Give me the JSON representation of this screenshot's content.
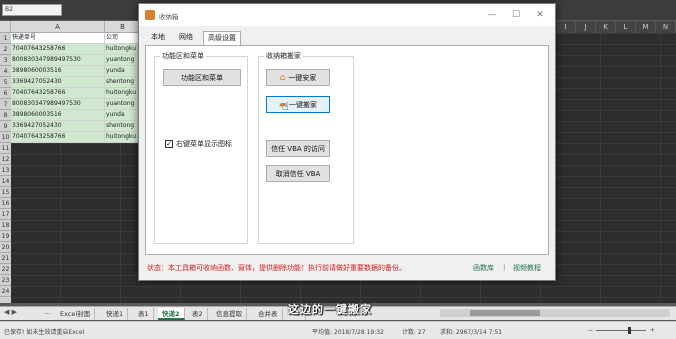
{
  "excel": {
    "name_box": "B2",
    "columns_left": [
      "A",
      "B"
    ],
    "columns_right": [
      "I",
      "J",
      "K",
      "L",
      "M",
      "N"
    ],
    "row_numbers": [
      "1",
      "2",
      "3",
      "4",
      "5",
      "6",
      "7",
      "8",
      "9",
      "10",
      "11",
      "12",
      "13",
      "14",
      "15",
      "16",
      "17",
      "18",
      "19",
      "20",
      "21",
      "22",
      "23",
      "24"
    ],
    "header_row": {
      "col_a": "快递单号",
      "col_b": "公司"
    },
    "rows": [
      {
        "a": "70407643258766",
        "b": "huitongku"
      },
      {
        "a": "8008303479894975​30",
        "b": "yuantong"
      },
      {
        "a": "3898060003516",
        "b": "yunda"
      },
      {
        "a": "3369427052430",
        "b": "shentong"
      },
      {
        "a": "70407643258766",
        "b": "huitongku"
      },
      {
        "a": "800830347989497530",
        "b": "yuantong"
      },
      {
        "a": "3898060003516",
        "b": "yunda"
      },
      {
        "a": "3369427052430",
        "b": "shentong"
      },
      {
        "a": "70407643258766",
        "b": "huitongku"
      }
    ],
    "tab_nav": "◀ ▶",
    "tab_more": "...",
    "sheet_tabs": [
      "Excel封面",
      "快递1",
      "表1",
      "快递2",
      "表2",
      "信息提取",
      "合并表"
    ],
    "active_sheet_index": 3,
    "add_sheet": "+",
    "status": {
      "ready": "已保存! 如未生效请重启Excel",
      "average": "平均值: 2018/7/28 19:32",
      "count": "计数: 27",
      "sum": "求和: 2967/3/14 7:51",
      "zoom_minus": "−",
      "zoom_plus": "+"
    }
  },
  "subtitle": "这边的一键搬家",
  "dialog": {
    "title": "收纳箱",
    "window_buttons": {
      "minimize": "—",
      "maximize": "☐",
      "close": "✕"
    },
    "tabs": [
      "本地",
      "网络",
      "高级设置"
    ],
    "active_tab_index": 2,
    "group_left_title": "功能区和菜单",
    "group_right_title": "收纳箱搬家",
    "btn_ribbon_menu": "功能区和菜单",
    "checkbox_label": "右键菜单显示图标",
    "checkbox_checked": "✓",
    "btn_install": "一键安家",
    "btn_move": "一键搬家",
    "btn_trust_vba": "信任 VBA 的访问",
    "btn_untrust_vba": "取消信任 VBA",
    "status_line": "状态：本工具箱可收纳函数、窗体，提供删除功能！执行前请做好重要数据的备份。",
    "link_functions": "函数库",
    "link_separator": "|",
    "link_video": "视频教程"
  },
  "colors": {
    "excel_green": "#217346",
    "status_red": "#d01f1f",
    "accent_blue": "#0078d7"
  }
}
